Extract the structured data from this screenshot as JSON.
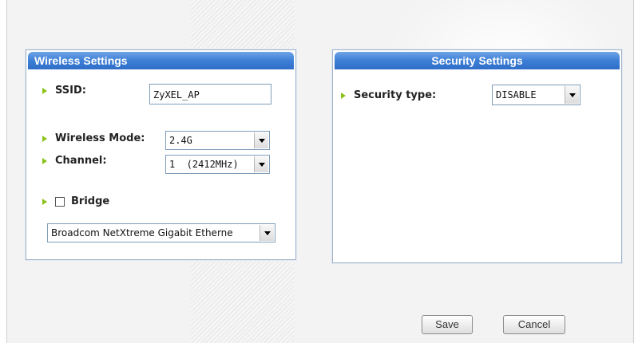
{
  "wireless": {
    "title": "Wireless Settings",
    "ssid_label": "SSID:",
    "ssid_value": "ZyXEL_AP",
    "mode_label": "Wireless Mode:",
    "mode_value": "2.4G",
    "channel_label": "Channel:",
    "channel_value": "1  (2412MHz)",
    "bridge_label": "Bridge",
    "bridge_checked": false,
    "adapter_value": "Broadcom NetXtreme Gigabit Etherne"
  },
  "security": {
    "title": "Security Settings",
    "type_label": "Security type:",
    "type_value": "DISABLE"
  },
  "actions": {
    "save_label": "Save",
    "cancel_label": "Cancel"
  },
  "icons": {
    "field_marker": "green-arrow-icon",
    "dropdown": "chevron-down-icon"
  },
  "colors": {
    "header_blue": "#3d7fd6",
    "marker_green": "#8bc21a"
  }
}
